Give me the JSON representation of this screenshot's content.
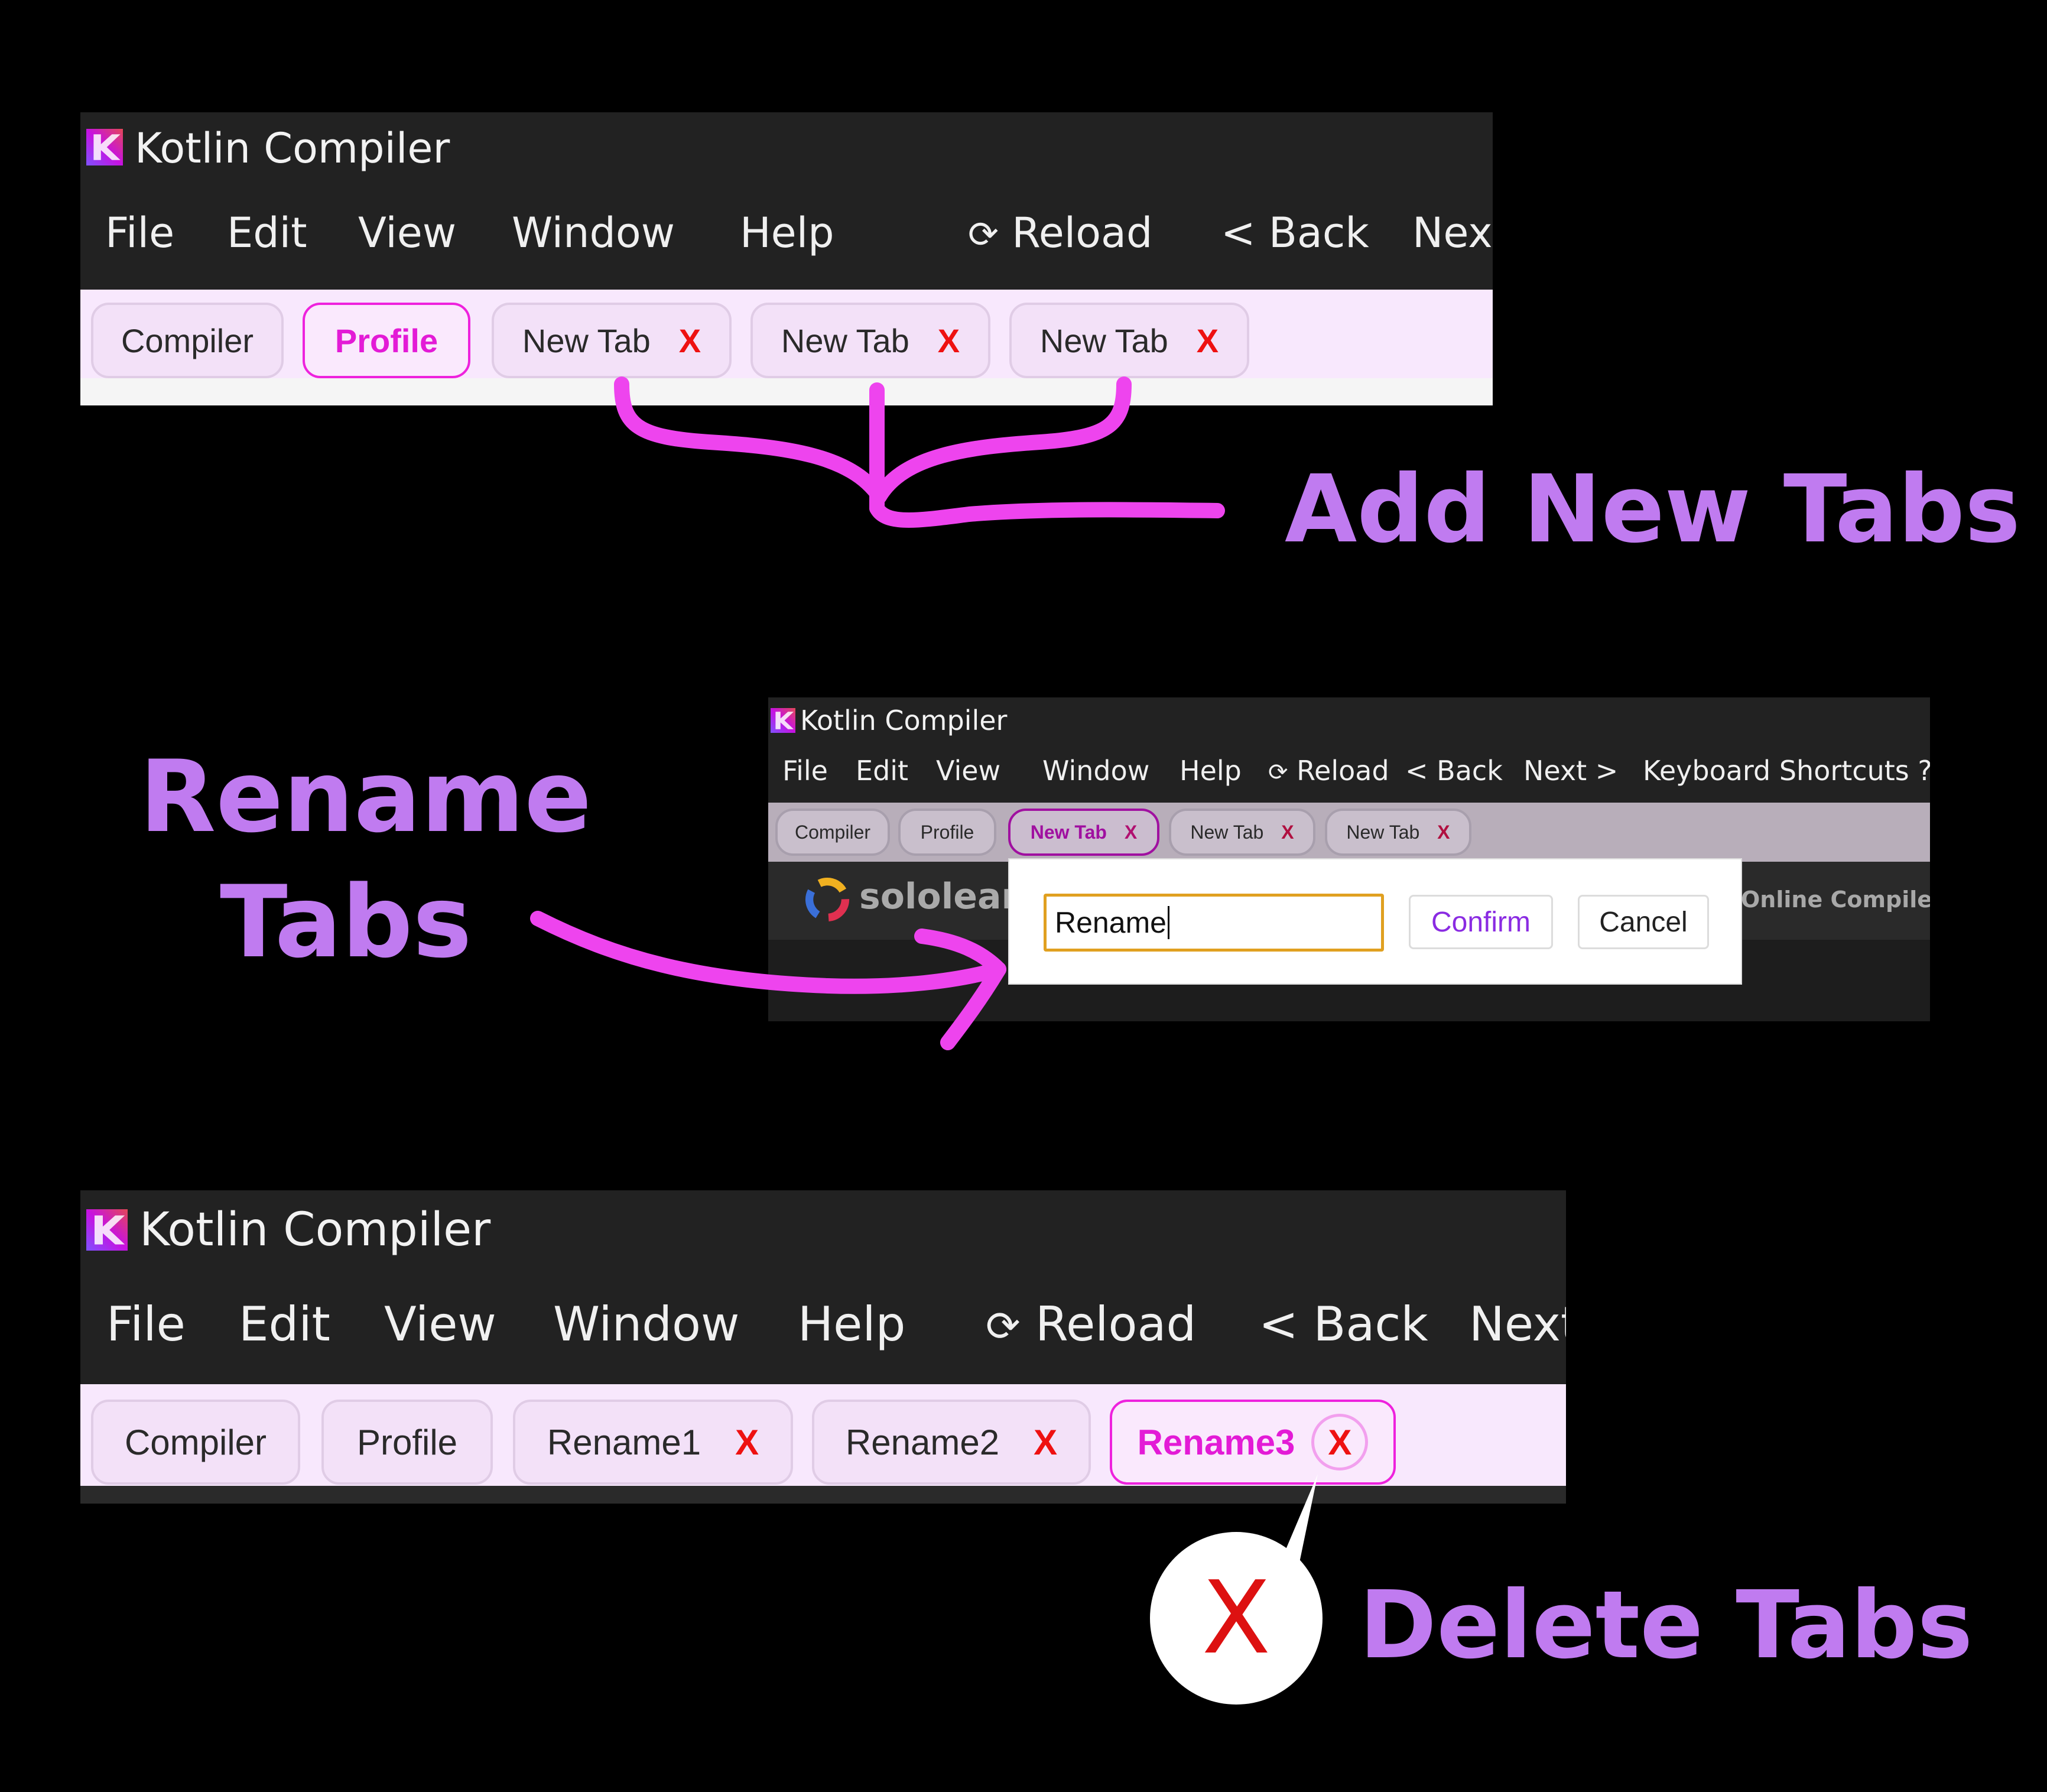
{
  "window_title": "Kotlin Compiler",
  "menu": {
    "file": "File",
    "edit": "Edit",
    "view": "View",
    "window": "Window",
    "help": "Help",
    "reload": "Reload",
    "back": "< Back",
    "next": "Next >",
    "next_short": "Next",
    "keyboard_shortcuts": "Keyboard Shortcuts ?"
  },
  "panel1": {
    "tabs": [
      "Compiler",
      "Profile",
      "New Tab",
      "New Tab",
      "New Tab"
    ],
    "close_label": "X",
    "active_tab": "Profile"
  },
  "panel2": {
    "tabs": [
      "Compiler",
      "Profile",
      "New Tab",
      "New Tab",
      "New Tab"
    ],
    "close_label": "X",
    "active_tab": "New Tab",
    "brand": "sololearn",
    "right_text": "Online Compiler &",
    "dialog": {
      "input_value": "Rename",
      "confirm": "Confirm",
      "cancel": "Cancel"
    }
  },
  "panel3": {
    "tabs": [
      "Compiler",
      "Profile",
      "Rename1",
      "Rename2",
      "Rename3"
    ],
    "close_label": "X",
    "active_tab": "Rename3"
  },
  "annotations": {
    "add": "Add New Tabs",
    "rename_line1": "Rename",
    "rename_line2": "Tabs",
    "delete": "Delete Tabs",
    "delete_icon": "X"
  },
  "colors": {
    "accent_magenta": "#ee22dd",
    "annotation_purple": "#c07bf0",
    "close_red": "#ee1111",
    "confirm_purple": "#8a2be2",
    "dialog_input_border": "#e0a020"
  }
}
